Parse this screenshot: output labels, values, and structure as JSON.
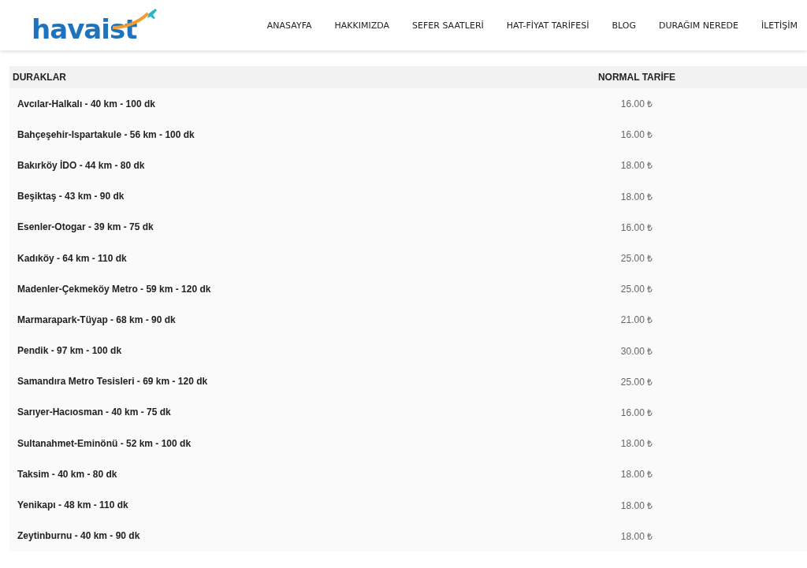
{
  "logo": {
    "text": "havaist"
  },
  "nav": [
    "ANASAYFA",
    "HAKKIMIZDA",
    "SEFER SAATLERİ",
    "HAT-FİYAT TARİFESİ",
    "BLOG",
    "DURAĞIM NEREDE",
    "İLETİŞİM"
  ],
  "table": {
    "columns": [
      "DURAKLAR",
      "NORMAL TARİFE"
    ],
    "rows": [
      {
        "stop": "Avcılar-Halkalı - 40 km - 100 dk",
        "fare": "16.00 ₺"
      },
      {
        "stop": "Bahçeşehir-Ispartakule - 56 km - 100 dk",
        "fare": "16.00 ₺"
      },
      {
        "stop": "Bakırköy İDO - 44 km - 80 dk",
        "fare": "18.00 ₺"
      },
      {
        "stop": "Beşiktaş - 43 km - 90 dk",
        "fare": "18.00 ₺"
      },
      {
        "stop": "Esenler-Otogar - 39 km - 75 dk",
        "fare": "16.00 ₺"
      },
      {
        "stop": "Kadıköy - 64 km - 110 dk",
        "fare": "25.00 ₺"
      },
      {
        "stop": "Madenler-Çekmeköy Metro - 59 km - 120 dk",
        "fare": "25.00 ₺"
      },
      {
        "stop": "Marmarapark-Tüyap - 68 km - 90 dk",
        "fare": "21.00 ₺"
      },
      {
        "stop": "Pendik - 97 km - 100 dk",
        "fare": "30.00 ₺"
      },
      {
        "stop": "Samandıra Metro Tesisleri - 69 km - 120 dk",
        "fare": "25.00 ₺"
      },
      {
        "stop": "Sarıyer-Hacıosman - 40 km - 75 dk",
        "fare": "16.00 ₺"
      },
      {
        "stop": "Sultanahmet-Eminönü - 52 km - 100 dk",
        "fare": "18.00 ₺"
      },
      {
        "stop": "Taksim - 40 km - 80 dk",
        "fare": "18.00 ₺"
      },
      {
        "stop": "Yenikapı - 48 km - 110 dk",
        "fare": "18.00 ₺"
      },
      {
        "stop": "Zeytinburnu - 40 km - 90 dk",
        "fare": "18.00 ₺"
      }
    ]
  }
}
